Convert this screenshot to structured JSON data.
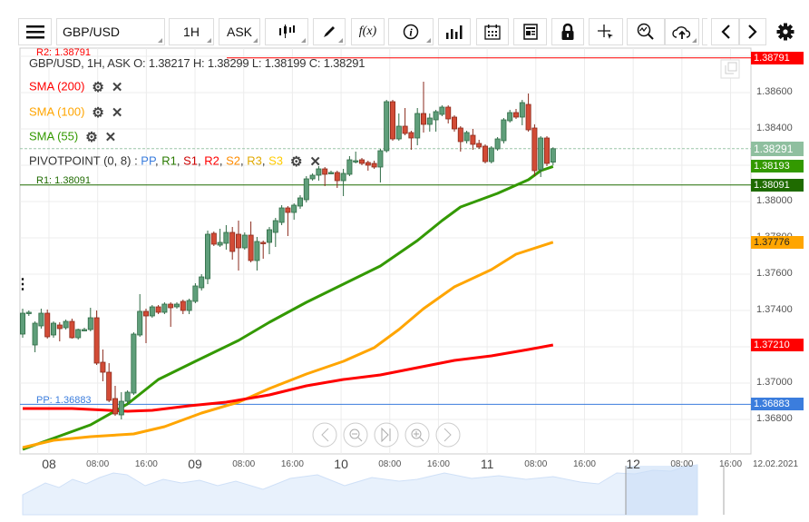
{
  "toolbar": {
    "symbol": "GBP/USD",
    "timeframe": "1H",
    "price_type": "ASK",
    "buttons": [
      "menu",
      "chart-type",
      "draw",
      "indicators",
      "info",
      "volume",
      "calendar",
      "news",
      "lock",
      "crosshair",
      "zoom",
      "cloud",
      "prev",
      "next",
      "settings"
    ],
    "fx_label": "f(x)"
  },
  "chart": {
    "header": "GBP/USD, 1H, ASK   O: 1.38217 H: 1.38299 L: 1.38199 C: 1.38291",
    "indicators": [
      {
        "label": "SMA (200)",
        "color": "#ff0000"
      },
      {
        "label": "SMA (100)",
        "color": "#ffa500"
      },
      {
        "label": "SMA (55)",
        "color": "#339900"
      }
    ],
    "pivot": {
      "label": "PIVOTPOINT (0, 8)",
      "sep": " : ",
      "parts": [
        {
          "t": "PP",
          "color": "#3b7ddd"
        },
        {
          "t": "R1",
          "color": "#2a7a00"
        },
        {
          "t": "S1",
          "color": "#cc0000"
        },
        {
          "t": "R2",
          "color": "#ff0000"
        },
        {
          "t": "S2",
          "color": "#ff8c00"
        },
        {
          "t": "R3",
          "color": "#e0a800"
        },
        {
          "t": "S3",
          "color": "#ffcc00"
        }
      ]
    },
    "levels": {
      "r2": {
        "label": "R2: 1.38791",
        "value": 1.38791,
        "badge": "1.38791",
        "color": "#ff0000"
      },
      "r1": {
        "label": "R1: 1.38091",
        "value": 1.38091,
        "badge": "1.38091",
        "color": "#1f6b00"
      },
      "pp": {
        "label": "PP: 1.36883",
        "value": 1.36883,
        "badge": "1.36883",
        "color": "#3b7ddd"
      }
    },
    "badges": {
      "current": {
        "text": "1.38291",
        "value": 1.38291,
        "color": "#8fbf9f"
      },
      "sma55": {
        "text": "1.38193",
        "color": "#339900"
      },
      "sma100": {
        "text": "1.37776",
        "color": "#ffa500"
      },
      "sma200": {
        "text": "1.37210",
        "color": "#ff0000"
      }
    },
    "price_ticks": [
      "1.38600",
      "1.38400",
      "1.38000",
      "1.37800",
      "1.37600",
      "1.37400",
      "1.37000",
      "1.36800"
    ],
    "time_ticks": [
      {
        "t": "08",
        "h": 0,
        "day": true
      },
      {
        "t": "08:00",
        "h": 8
      },
      {
        "t": "16:00",
        "h": 16
      },
      {
        "t": "09",
        "h": 24,
        "day": true
      },
      {
        "t": "08:00",
        "h": 32
      },
      {
        "t": "16:00",
        "h": 40
      },
      {
        "t": "10",
        "h": 48,
        "day": true
      },
      {
        "t": "08:00",
        "h": 56
      },
      {
        "t": "16:00",
        "h": 64
      },
      {
        "t": "11",
        "h": 72,
        "day": true
      },
      {
        "t": "08:00",
        "h": 80
      },
      {
        "t": "16:00",
        "h": 88
      },
      {
        "t": "12",
        "h": 96,
        "day": true
      },
      {
        "t": "08:00",
        "h": 104
      },
      {
        "t": "16:00",
        "h": 112
      },
      {
        "t": "12.02.2021",
        "h": 120
      }
    ]
  },
  "chart_data": {
    "type": "candlestick",
    "up_color": "#5f9e7a",
    "down_color": "#d24b36",
    "ohlc": [
      [
        1.3727,
        1.3741,
        1.3725,
        1.37385
      ],
      [
        1.37385,
        1.374,
        1.3737,
        1.3739
      ],
      [
        1.3721,
        1.3734,
        1.3717,
        1.3733
      ],
      [
        1.37315,
        1.3741,
        1.373,
        1.37385
      ],
      [
        1.37385,
        1.37405,
        1.37245,
        1.37255
      ],
      [
        1.37265,
        1.3734,
        1.3725,
        1.3733
      ],
      [
        1.3732,
        1.37335,
        1.3723,
        1.373
      ],
      [
        1.37305,
        1.3735,
        1.37295,
        1.3734
      ],
      [
        1.3734,
        1.37355,
        1.37245,
        1.3725
      ],
      [
        1.3725,
        1.373,
        1.3724,
        1.37295
      ],
      [
        1.37295,
        1.37305,
        1.37285,
        1.37295
      ],
      [
        1.37295,
        1.37415,
        1.37285,
        1.3736
      ],
      [
        1.3736,
        1.374,
        1.371,
        1.3711
      ],
      [
        1.37115,
        1.37185,
        1.3701,
        1.3706
      ],
      [
        1.3706,
        1.3711,
        1.36895,
        1.36905
      ],
      [
        1.36915,
        1.36985,
        1.3682,
        1.3683
      ],
      [
        1.36825,
        1.3695,
        1.368,
        1.369
      ],
      [
        1.369,
        1.3696,
        1.3688,
        1.3695
      ],
      [
        1.36945,
        1.3728,
        1.36935,
        1.3727
      ],
      [
        1.37265,
        1.3749,
        1.37255,
        1.37395
      ],
      [
        1.37395,
        1.3741,
        1.3722,
        1.3737
      ],
      [
        1.3737,
        1.3743,
        1.3736,
        1.3742
      ],
      [
        1.3742,
        1.3743,
        1.3738,
        1.3739
      ],
      [
        1.3739,
        1.37445,
        1.3738,
        1.37435
      ],
      [
        1.37435,
        1.37445,
        1.3731,
        1.37415
      ],
      [
        1.3742,
        1.37445,
        1.3741,
        1.37435
      ],
      [
        1.3745,
        1.3746,
        1.3738,
        1.374
      ],
      [
        1.374,
        1.37465,
        1.3738,
        1.37455
      ],
      [
        1.3745,
        1.3755,
        1.3744,
        1.37535
      ],
      [
        1.37525,
        1.376,
        1.3751,
        1.37585
      ],
      [
        1.37575,
        1.3784,
        1.37545,
        1.3782
      ],
      [
        1.37825,
        1.37835,
        1.37755,
        1.37765
      ],
      [
        1.3776,
        1.3785,
        1.3775,
        1.37775
      ],
      [
        1.3777,
        1.3787,
        1.37735,
        1.3783
      ],
      [
        1.3783,
        1.3786,
        1.3768,
        1.37725
      ],
      [
        1.3782,
        1.37895,
        1.3762,
        1.37745
      ],
      [
        1.37745,
        1.3783,
        1.37735,
        1.37815
      ],
      [
        1.37815,
        1.3789,
        1.37665,
        1.37675
      ],
      [
        1.37675,
        1.37805,
        1.3762,
        1.3778
      ],
      [
        1.37775,
        1.37785,
        1.37685,
        1.3777
      ],
      [
        1.37775,
        1.3786,
        1.3771,
        1.37845
      ],
      [
        1.3783,
        1.3791,
        1.3775,
        1.37895
      ],
      [
        1.37885,
        1.3798,
        1.3787,
        1.37965
      ],
      [
        1.37965,
        1.37975,
        1.3781,
        1.3794
      ],
      [
        1.3794,
        1.3799,
        1.379,
        1.3798
      ],
      [
        1.37975,
        1.38035,
        1.3796,
        1.3802
      ],
      [
        1.3801,
        1.3814,
        1.37995,
        1.38125
      ],
      [
        1.38125,
        1.38155,
        1.38115,
        1.38145
      ],
      [
        1.38145,
        1.38195,
        1.38115,
        1.3818
      ],
      [
        1.3818,
        1.3819,
        1.38085,
        1.3815
      ],
      [
        1.3816,
        1.3817,
        1.3815,
        1.3816
      ],
      [
        1.3816,
        1.3817,
        1.38075,
        1.38115
      ],
      [
        1.38115,
        1.3818,
        1.3803,
        1.38155
      ],
      [
        1.3815,
        1.3825,
        1.3814,
        1.3823
      ],
      [
        1.38225,
        1.38275,
        1.3821,
        1.38225
      ],
      [
        1.3823,
        1.3824,
        1.382,
        1.3821
      ],
      [
        1.38215,
        1.38225,
        1.3817,
        1.382
      ],
      [
        1.3821,
        1.38225,
        1.3818,
        1.3819
      ],
      [
        1.3819,
        1.3829,
        1.38105,
        1.3828
      ],
      [
        1.3828,
        1.3856,
        1.3827,
        1.3855
      ],
      [
        1.3855,
        1.3856,
        1.38335,
        1.38345
      ],
      [
        1.38345,
        1.38485,
        1.38335,
        1.38415
      ],
      [
        1.38415,
        1.38515,
        1.38365,
        1.38375
      ],
      [
        1.3838,
        1.3839,
        1.38285,
        1.3835
      ],
      [
        1.3835,
        1.38515,
        1.3831,
        1.38485
      ],
      [
        1.38485,
        1.3866,
        1.3838,
        1.38425
      ],
      [
        1.38425,
        1.38485,
        1.38385,
        1.3846
      ],
      [
        1.3845,
        1.38505,
        1.38385,
        1.38495
      ],
      [
        1.3848,
        1.3853,
        1.3847,
        1.3852
      ],
      [
        1.3852,
        1.3853,
        1.3843,
        1.38455
      ],
      [
        1.38465,
        1.38475,
        1.38385,
        1.384
      ],
      [
        1.38405,
        1.38415,
        1.38275,
        1.3833
      ],
      [
        1.38335,
        1.3839,
        1.3832,
        1.3838
      ],
      [
        1.38365,
        1.384,
        1.38285,
        1.38315
      ],
      [
        1.3832,
        1.3834,
        1.3829,
        1.383
      ],
      [
        1.38305,
        1.38315,
        1.3821,
        1.3822
      ],
      [
        1.3822,
        1.38305,
        1.3821,
        1.38295
      ],
      [
        1.3829,
        1.38355,
        1.3828,
        1.38345
      ],
      [
        1.38335,
        1.3846,
        1.3832,
        1.3845
      ],
      [
        1.38445,
        1.38505,
        1.38435,
        1.3849
      ],
      [
        1.3849,
        1.3851,
        1.38455,
        1.38465
      ],
      [
        1.38465,
        1.3856,
        1.3842,
        1.38545
      ],
      [
        1.38535,
        1.38595,
        1.38385,
        1.38395
      ],
      [
        1.38405,
        1.38425,
        1.3814,
        1.3817
      ],
      [
        1.38175,
        1.3836,
        1.38135,
        1.3835
      ],
      [
        1.3835,
        1.3836,
        1.38195,
        1.3821
      ],
      [
        1.38217,
        1.38299,
        1.38199,
        1.38291
      ]
    ],
    "sma": [
      {
        "name": "SMA (55)",
        "color": "#339900",
        "points": [
          [
            0,
            1.36635
          ],
          [
            11,
            1.3677
          ],
          [
            17,
            1.36885
          ],
          [
            22,
            1.3702
          ],
          [
            28,
            1.3712
          ],
          [
            35,
            1.37235
          ],
          [
            40,
            1.37335
          ],
          [
            46,
            1.37445
          ],
          [
            52,
            1.37545
          ],
          [
            58,
            1.37645
          ],
          [
            64,
            1.37785
          ],
          [
            68,
            1.37895
          ],
          [
            71,
            1.3797
          ],
          [
            77,
            1.38045
          ],
          [
            82,
            1.3812
          ],
          [
            84,
            1.3817
          ],
          [
            86,
            1.38193
          ]
        ]
      },
      {
        "name": "SMA (100)",
        "color": "#ffa500",
        "points": [
          [
            0,
            1.36645
          ],
          [
            5,
            1.36685
          ],
          [
            11,
            1.36705
          ],
          [
            18,
            1.3672
          ],
          [
            23,
            1.3676
          ],
          [
            29,
            1.36835
          ],
          [
            35,
            1.36895
          ],
          [
            40,
            1.3697
          ],
          [
            46,
            1.3705
          ],
          [
            52,
            1.3712
          ],
          [
            57,
            1.37195
          ],
          [
            61,
            1.37295
          ],
          [
            65,
            1.3741
          ],
          [
            70,
            1.3753
          ],
          [
            76,
            1.37625
          ],
          [
            80,
            1.3771
          ],
          [
            86,
            1.37776
          ]
        ]
      },
      {
        "name": "SMA (200)",
        "color": "#ff0000",
        "points": [
          [
            0,
            1.3686
          ],
          [
            8,
            1.3686
          ],
          [
            17,
            1.36845
          ],
          [
            21,
            1.3685
          ],
          [
            27,
            1.36875
          ],
          [
            33,
            1.36895
          ],
          [
            40,
            1.36935
          ],
          [
            46,
            1.36985
          ],
          [
            52,
            1.3702
          ],
          [
            58,
            1.37045
          ],
          [
            64,
            1.37085
          ],
          [
            70,
            1.37125
          ],
          [
            76,
            1.3715
          ],
          [
            82,
            1.37185
          ],
          [
            86,
            1.3721
          ]
        ]
      }
    ]
  }
}
